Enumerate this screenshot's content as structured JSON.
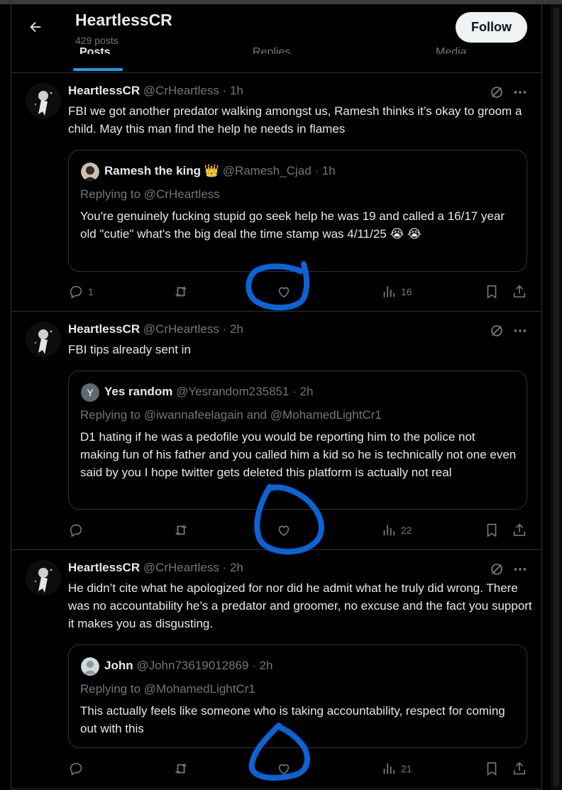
{
  "profile": {
    "name": "HeartlessCR",
    "posts_count": "429 posts",
    "follow_label": "Follow"
  },
  "tabs": [
    "Posts",
    "Replies",
    "Media"
  ],
  "tweets": [
    {
      "name": "HeartlessCR",
      "handle_time": "@CrHeartless · 1h",
      "text": "FBI we got another predator walking amongst us, Ramesh thinks it’s okay to groom a child. May this man find the help he needs in flames",
      "quote": {
        "name": "Ramesh the king",
        "emoji": "👑",
        "handle_time": "@Ramesh_Cjad · 1h",
        "replying": "Replying to @CrHeartless",
        "text": "You're genuinely fucking stupid go seek help he was 19 and called a 16/17 year old \"cutie\" what's the big deal the time stamp was 4/11/25 😭 😭"
      },
      "stats": {
        "replies": "1",
        "views": "16"
      }
    },
    {
      "name": "HeartlessCR",
      "handle_time": "@CrHeartless · 2h",
      "text": "FBI tips already sent in",
      "quote": {
        "name": "Yes random",
        "avatar_letter": "Y",
        "handle_time": "@Yesrandom235851 · 2h",
        "replying": "Replying to @iwannafeelagain and @MohamedLightCr1",
        "text": "D1 hating if he was a pedofile you would be reporting him to the police not making fun of his father and you called him a kid so he is technically not one even said by you I hope twitter gets deleted this platform is actually not real"
      },
      "stats": {
        "replies": "",
        "views": "22"
      }
    },
    {
      "name": "HeartlessCR",
      "handle_time": "@CrHeartless · 2h",
      "text": "He didn’t cite what he apologized for nor did he admit what he truly did wrong. There was no accountability he’s a predator and groomer, no excuse and the fact you support it makes you as disgusting.",
      "quote": {
        "name": "John",
        "handle_time": "@John73619012869 · 2h",
        "replying": "Replying to @MohamedLightCr1",
        "text": "This actually feels like someone who is taking accountability, respect for coming out with this"
      },
      "stats": {
        "replies": "",
        "views": "21"
      }
    }
  ],
  "colors": {
    "accent": "#1d9bf0",
    "annotation": "#0a64d6",
    "muted": "#71767b",
    "text": "#e7e9ea",
    "border": "#2f3336"
  },
  "icons": [
    "back-arrow-icon",
    "grok-icon",
    "more-icon",
    "reply-icon",
    "retweet-icon",
    "like-icon",
    "views-icon",
    "bookmark-icon",
    "share-icon"
  ]
}
